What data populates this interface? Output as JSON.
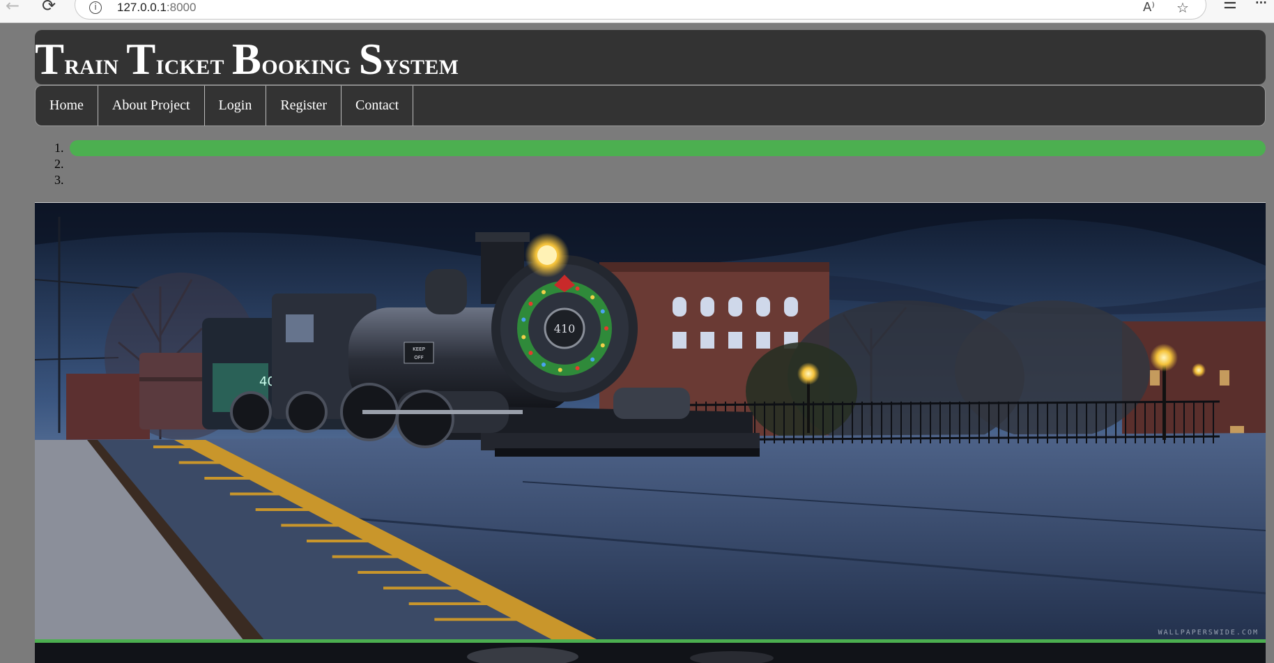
{
  "browser": {
    "url_host": "127.0.0.1",
    "url_port": ":8000"
  },
  "header": {
    "title_words": [
      {
        "cap": "T",
        "rest": "rain"
      },
      {
        "cap": "T",
        "rest": "icket"
      },
      {
        "cap": "B",
        "rest": "ooking"
      },
      {
        "cap": "S",
        "rest": "ystem"
      }
    ]
  },
  "nav": {
    "items": [
      {
        "label": "Home"
      },
      {
        "label": "About Project"
      },
      {
        "label": "Login"
      },
      {
        "label": "Register"
      },
      {
        "label": "Contact"
      }
    ]
  },
  "slider": {
    "indicators": [
      "1.",
      "2.",
      "3."
    ],
    "active_index": 0,
    "active_color": "#4caf50",
    "watermark": "WALLPAPERSWIDE.COM"
  },
  "colors": {
    "page_bg": "#7b7b7b",
    "header_bg": "#333333",
    "accent": "#4caf50"
  },
  "icons": {
    "back": "arrow-left-icon",
    "reload": "reload-icon",
    "info": "info-icon",
    "read_aloud": "read-aloud-icon",
    "favorite": "star-icon",
    "favorites": "favorites-icon",
    "menu": "menu-dots-icon"
  }
}
